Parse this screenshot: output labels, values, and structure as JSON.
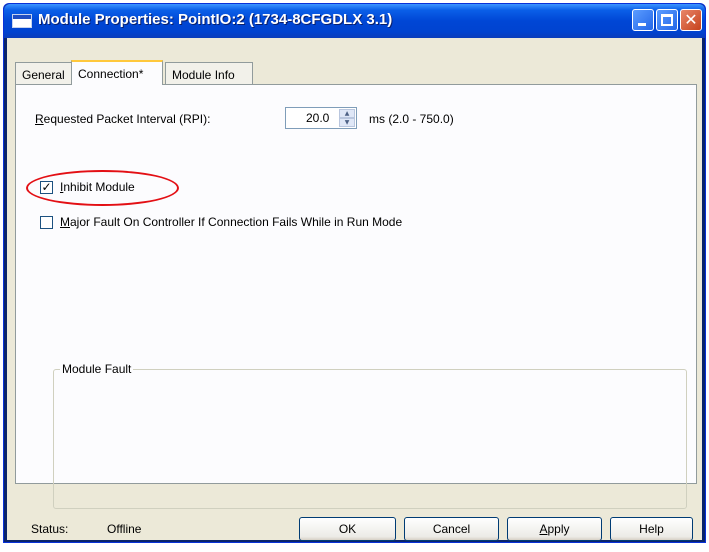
{
  "window": {
    "title": "Module Properties: PointIO:2 (1734-8CFGDLX 3.1)",
    "icons": [
      "window-app-icon",
      "minimize-icon",
      "maximize-icon",
      "close-icon"
    ],
    "close_glyph": "✕"
  },
  "tabs": [
    {
      "label": "General",
      "active": false
    },
    {
      "label": "Connection*",
      "active": true
    },
    {
      "label": "Module Info",
      "active": false
    }
  ],
  "connection": {
    "rpi_label": "Requested Packet Interval (RPI):",
    "rpi_value": "20.0",
    "rpi_unit_range": "ms (2.0 - 750.0)",
    "spin_up": "▲",
    "spin_down": "▼",
    "inhibit_label": "Inhibit Module",
    "inhibit_checked": true,
    "check_glyph": "✓",
    "major_fault_label": "Major Fault On Controller If Connection Fails While in Run Mode",
    "major_fault_checked": false,
    "module_fault_title": "Module Fault"
  },
  "annotation": {
    "color": "#e30f14"
  },
  "status": {
    "label": "Status:",
    "value": "Offline"
  },
  "buttons": {
    "ok": "OK",
    "cancel": "Cancel",
    "apply": "Apply",
    "help": "Help"
  },
  "colors": {
    "titlebar": "#0046d5",
    "dialog_bg": "#ece9d8",
    "close_button": "#c6421c",
    "active_tab_accent": "#ffc83c"
  }
}
